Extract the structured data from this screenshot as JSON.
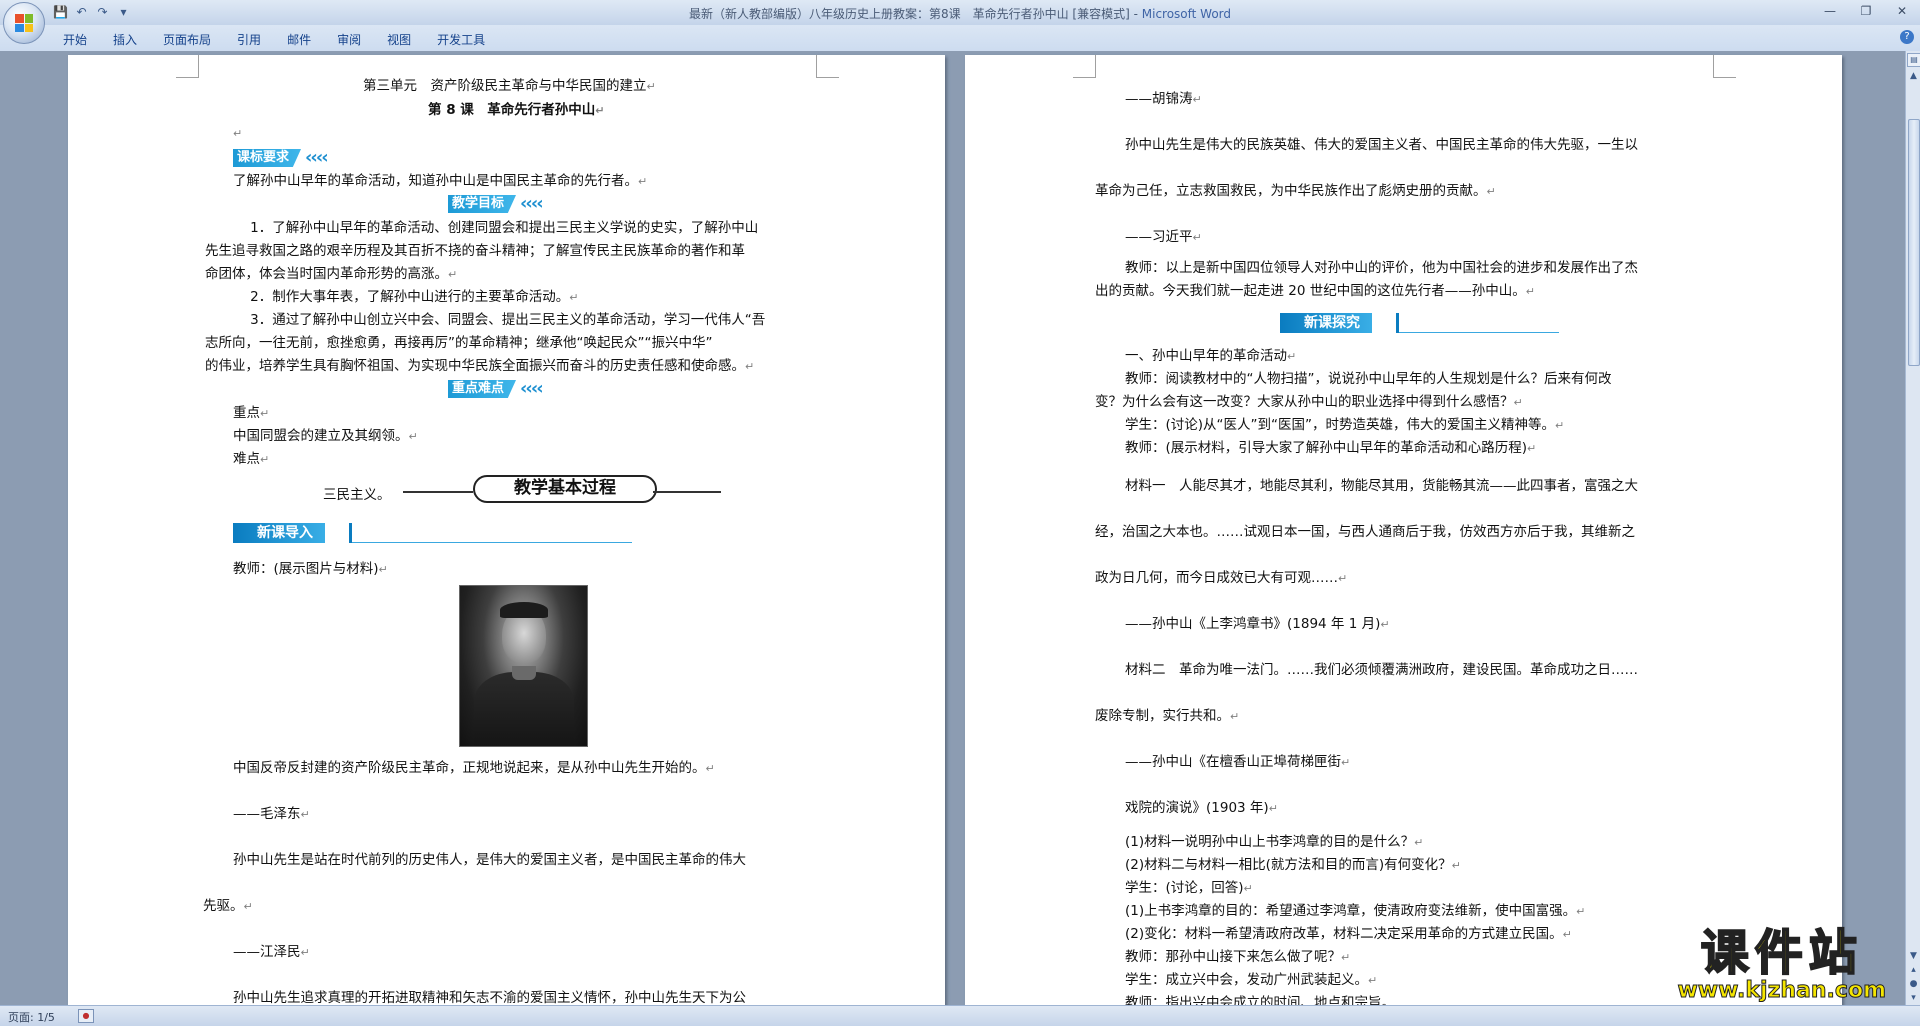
{
  "window": {
    "title": "最新（新人教部编版）八年级历史上册教案：第8课　革命先行者孙中山 [兼容模式] -",
    "app_name": "Microsoft Word",
    "minimize": "—",
    "restore": "❐",
    "close": "✕"
  },
  "qat": {
    "save": "💾",
    "undo": "↶",
    "redo": "↷",
    "more": "▾"
  },
  "ribbon": {
    "tabs": [
      "开始",
      "插入",
      "页面布局",
      "引用",
      "邮件",
      "审阅",
      "视图",
      "开发工具"
    ],
    "help": "?"
  },
  "page1": {
    "unit_title": "第三单元　资产阶级民主革命与中华民国的建立",
    "lesson_title": "第 8 课　革命先行者孙中山",
    "banner_course_req": "课标要求",
    "course_req_text": "了解孙中山早年的革命活动，知道孙中山是中国民主革命的先行者。",
    "banner_goals": "教学目标",
    "goal1_a": "1．了解孙中山早年的革命活动、创建同盟会和提出三民主义学说的史实，了解孙中山",
    "goal1_b": "先生追寻救国之路的艰辛历程及其百折不挠的奋斗精神；了解宣传民主民族革命的著作和革",
    "goal1_c": "命团体，体会当时国内革命形势的高涨。",
    "goal2": "2．制作大事年表，了解孙中山进行的主要革命活动。",
    "goal3_a": "3．通过了解孙中山创立兴中会、同盟会、提出三民主义的革命活动，学习一代伟人“吾",
    "goal3_b": "志所向，一往无前，愈挫愈勇，再接再厉”的革命精神；继承他“唤起民众”“振兴中华”",
    "goal3_c": "的伟业，培养学生具有胸怀祖国、为实现中华民族全面振兴而奋斗的历史责任感和使命感。",
    "banner_key": "重点难点",
    "key_label": "重点",
    "key_text": "中国同盟会的建立及其纲领。",
    "diff_label": "难点",
    "diff_text": "三民主义。",
    "process_banner": "教学基本过程",
    "new_intro_banner": "新课导入",
    "teacher_show": "教师：(展示图片与材料)",
    "quote_mao": "中国反帝反封建的资产阶级民主革命，正规地说起来，是从孙中山先生开始的。",
    "attr_mao": "——毛泽东",
    "quote_jiang_a": "孙中山先生是站在时代前列的历史伟人，是伟大的爱国主义者，是中国民主革命的伟大",
    "quote_jiang_b": "先驱。",
    "attr_jiang": "——江泽民",
    "quote_hu_a": "孙中山先生追求真理的开拓进取精神和矢志不渝的爱国主义情怀，孙中山先生天下为公"
  },
  "page2": {
    "attr_hu": "——胡锦涛",
    "quote_xi_a": "孙中山先生是伟大的民族英雄、伟大的爱国主义者、中国民主革命的伟大先驱，一生以",
    "quote_xi_b": "革命为己任，立志救国救民，为中华民族作出了彪炳史册的贡献。",
    "attr_xi": "——习近平",
    "teacher_intro_a": "教师：以上是新中国四位领导人对孙中山的评价，他为中国社会的进步和发展作出了杰",
    "teacher_intro_b": "出的贡献。今天我们就一起走进 20 世纪中国的这位先行者——孙中山。",
    "new_explore_banner": "新课探究",
    "section1": "一、孙中山早年的革命活动",
    "teacher_q_a": "教师：阅读教材中的“人物扫描”，说说孙中山早年的人生规划是什么？后来有何改",
    "teacher_q_b": "变？为什么会有这一改变？大家从孙中山的职业选择中得到什么感悟？",
    "student_a": "学生：(讨论)从“医人”到“医国”，时势造英雄，伟大的爱国主义精神等。",
    "teacher_show2": "教师：(展示材料，引导大家了解孙中山早年的革命活动和心路历程)",
    "mat1_a": "材料一　人能尽其才，地能尽其利，物能尽其用，货能畅其流——此四事者，富强之大",
    "mat1_b": "经，治国之大本也。……试观日本一国，与西人通商后于我，仿效西方亦后于我，其维新之",
    "mat1_c": "政为日几何，而今日成效已大有可观……",
    "mat1_src": "——孙中山《上李鸿章书》(1894 年 1 月)",
    "mat2_a": "材料二　革命为唯一法门。……我们必须倾覆满洲政府，建设民国。革命成功之日……",
    "mat2_b": "废除专制，实行共和。",
    "mat2_src_a": "——孙中山《在檀香山正埠荷梯匣街",
    "mat2_src_b": "戏院的演说》(1903 年)",
    "q1": "(1)材料一说明孙中山上书李鸿章的目的是什么？",
    "q2": "(2)材料二与材料一相比(就方法和目的而言)有何变化？",
    "student_b": "学生：(讨论，回答)",
    "a1": "(1)上书李鸿章的目的：希望通过李鸿章，使清政府变法维新，使中国富强。",
    "a2": "(2)变化：材料一希望清政府改革，材料二决定采用革命的方式建立民国。",
    "teacher_next": "教师：那孙中山接下来怎么做了呢？",
    "student_c": "学生：成立兴中会，发动广州武装起义。",
    "teacher_last": "教师：指出兴中会成立的时间、地点和宗旨。"
  },
  "statusbar": {
    "page": "页面: 1/5"
  },
  "watermark": {
    "big": "课件站",
    "url": "www.kjzhan.com"
  },
  "colors": {
    "banner_blue": "#1d9ad6",
    "workspace": "#8c9cb2",
    "ribbon": "#dbe6f4",
    "watermark": "#f5e600"
  }
}
